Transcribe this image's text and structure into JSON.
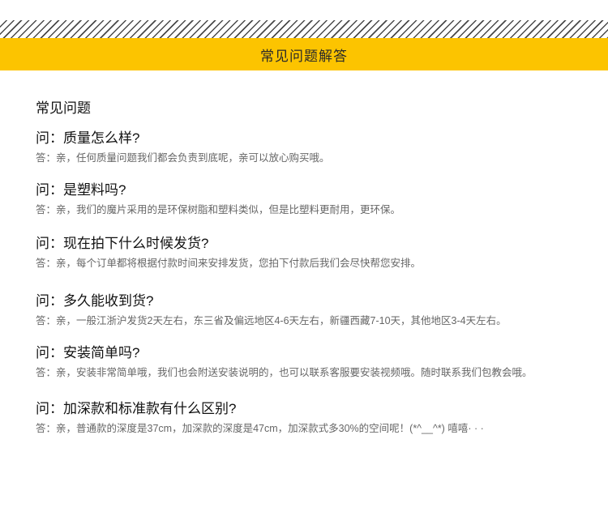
{
  "banner": {
    "title": "常见问题解答"
  },
  "section": {
    "heading": "常见问题"
  },
  "faqs": [
    {
      "question": "问：质量怎么样?",
      "answer": "答：亲，任何质量问题我们都会负责到底呢，亲可以放心购买哦。"
    },
    {
      "question": "问：是塑料吗?",
      "answer": "答：亲，我们的魔片采用的是环保树脂和塑料类似，但是比塑料更耐用，更环保。"
    },
    {
      "question": "问：现在拍下什么时候发货?",
      "answer": "答：亲，每个订单都将根据付款时间来安排发货，您拍下付款后我们会尽快帮您安排。"
    },
    {
      "question": "问：多久能收到货?",
      "answer": "答：亲，一般江浙沪发货2天左右，东三省及偏远地区4-6天左右，新疆西藏7-10天，其他地区3-4天左右。"
    },
    {
      "question": "问：安装简单吗?",
      "answer": "答：亲，安装非常简单哦，我们也会附送安装说明的，也可以联系客服要安装视频哦。随时联系我们包教会哦。"
    },
    {
      "question": "问：加深款和标准款有什么区别?",
      "answer": "答：亲，普通款的深度是37cm，加深款的深度是47cm，加深款式多30%的空间呢！(*^__^*) 嘻嘻·  ·  ·"
    }
  ]
}
